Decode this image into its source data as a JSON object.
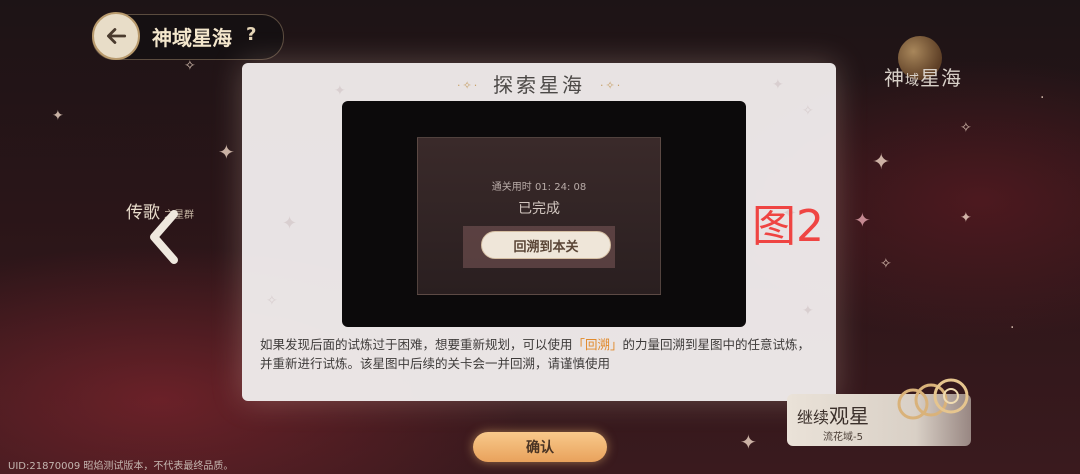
{
  "header": {
    "back_icon": "arrow-left-icon",
    "title": "神域星海",
    "help": "?"
  },
  "emblem": {
    "big": "神",
    "small": "域",
    "rest": "星海"
  },
  "left_nav": {
    "label": "传歌",
    "sub": "之星群",
    "icon": "chevron-left-icon"
  },
  "dialog": {
    "title": "探索星海",
    "title_deco": "·✧·",
    "preview": {
      "clear_time": "通关用时 01: 24: 08",
      "completed": "已完成",
      "rewind_button": "回溯到本关"
    },
    "description": {
      "part1": "如果发现后面的试炼过于困难，想要重新规划，可以使用",
      "highlight": "「回溯」",
      "part2": "的力量回溯到星图中的任意试炼，并重新进行试炼。该星图中后续的关卡会一并回溯，请谨慎使用"
    }
  },
  "figure_label": "图2",
  "confirm_button": "确认",
  "continue_card": {
    "title_a": "继续",
    "title_b": "观星",
    "subtitle": "流花域-5"
  },
  "footer": {
    "uid": "UID:21870009 昭焰测试版本，不代表最终品质。"
  },
  "colors": {
    "highlight": "#e18a2c",
    "figure_label": "#ef4442",
    "confirm_bg": "#e9a25c"
  }
}
